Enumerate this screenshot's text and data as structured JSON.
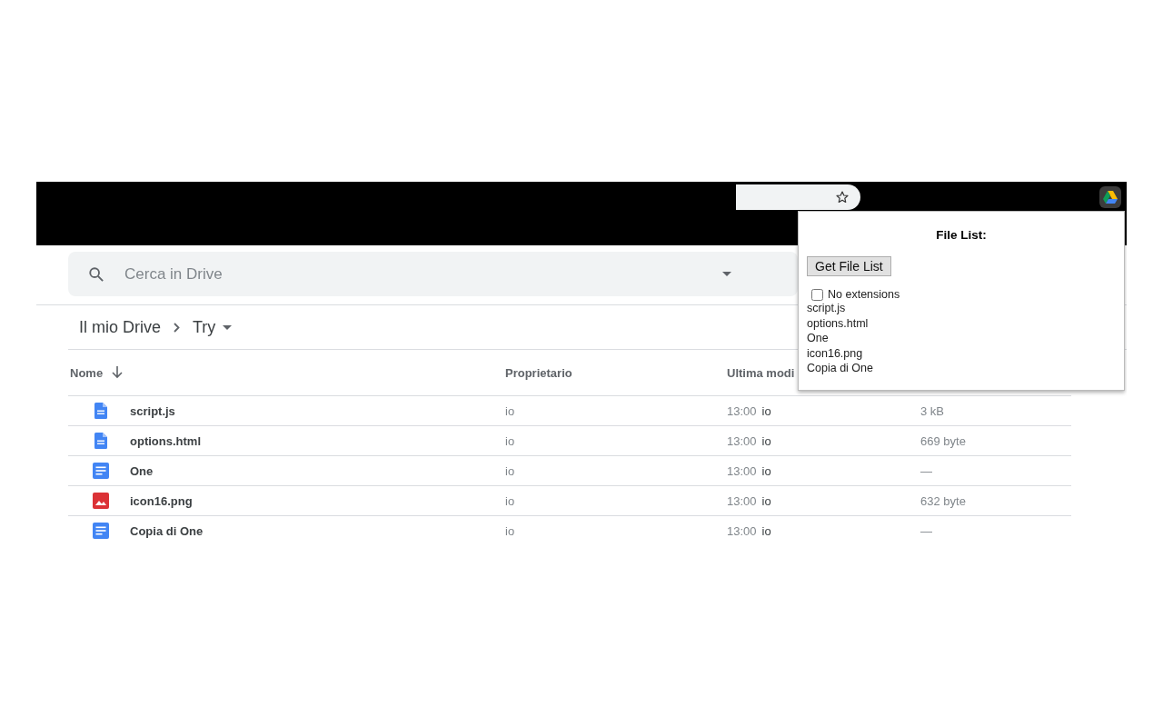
{
  "search": {
    "placeholder": "Cerca in Drive"
  },
  "breadcrumb": [
    "Il mio Drive",
    "Try"
  ],
  "table": {
    "columns": [
      {
        "label": "Nome",
        "sorted": true
      },
      {
        "label": "Proprietario",
        "sorted": false
      },
      {
        "label": "Ultima modi",
        "sorted": false
      }
    ],
    "rows": [
      {
        "kind": "file",
        "name": "script.js",
        "owner": "io",
        "time": "13:00",
        "modified_by": "io",
        "size": "3 kB"
      },
      {
        "kind": "file",
        "name": "options.html",
        "owner": "io",
        "time": "13:00",
        "modified_by": "io",
        "size": "669 byte"
      },
      {
        "kind": "doc",
        "name": "One",
        "owner": "io",
        "time": "13:00",
        "modified_by": "io",
        "size": "—"
      },
      {
        "kind": "image",
        "name": "icon16.png",
        "owner": "io",
        "time": "13:00",
        "modified_by": "io",
        "size": "632 byte"
      },
      {
        "kind": "doc",
        "name": "Copia di One",
        "owner": "io",
        "time": "13:00",
        "modified_by": "io",
        "size": "—"
      }
    ]
  },
  "popup": {
    "title": "File List:",
    "button": "Get File List",
    "checkbox": {
      "label": "No extensions",
      "checked": false
    },
    "files": [
      "script.js",
      "options.html",
      "One",
      "icon16.png",
      "Copia di One"
    ]
  }
}
